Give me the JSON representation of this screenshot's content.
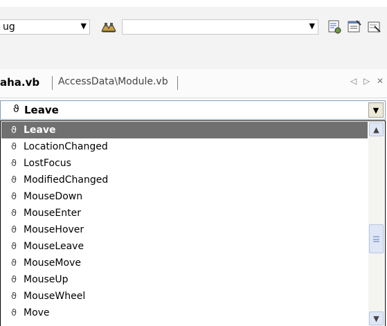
{
  "toolbar": {
    "config_value": "ug",
    "search_value": "",
    "icons": [
      "find-in-files-icon",
      "solution-explorer-icon",
      "properties-icon",
      "toolbox-icon"
    ]
  },
  "tabs": {
    "active_label": "aha.vb",
    "second_label": "AccessData\\Module.vb",
    "nav_left": "◁",
    "nav_right": "▷",
    "close": "✕"
  },
  "member_combo": {
    "bolt": "ϑ",
    "value": "Leave"
  },
  "events_list": {
    "bolt": "ϑ",
    "selected_index": 0,
    "items": [
      "Leave",
      "LocationChanged",
      "LostFocus",
      "ModifiedChanged",
      "MouseDown",
      "MouseEnter",
      "MouseHover",
      "MouseLeave",
      "MouseMove",
      "MouseUp",
      "MouseWheel",
      "Move"
    ]
  },
  "scrollbar": {
    "position_fraction": 0.6
  }
}
